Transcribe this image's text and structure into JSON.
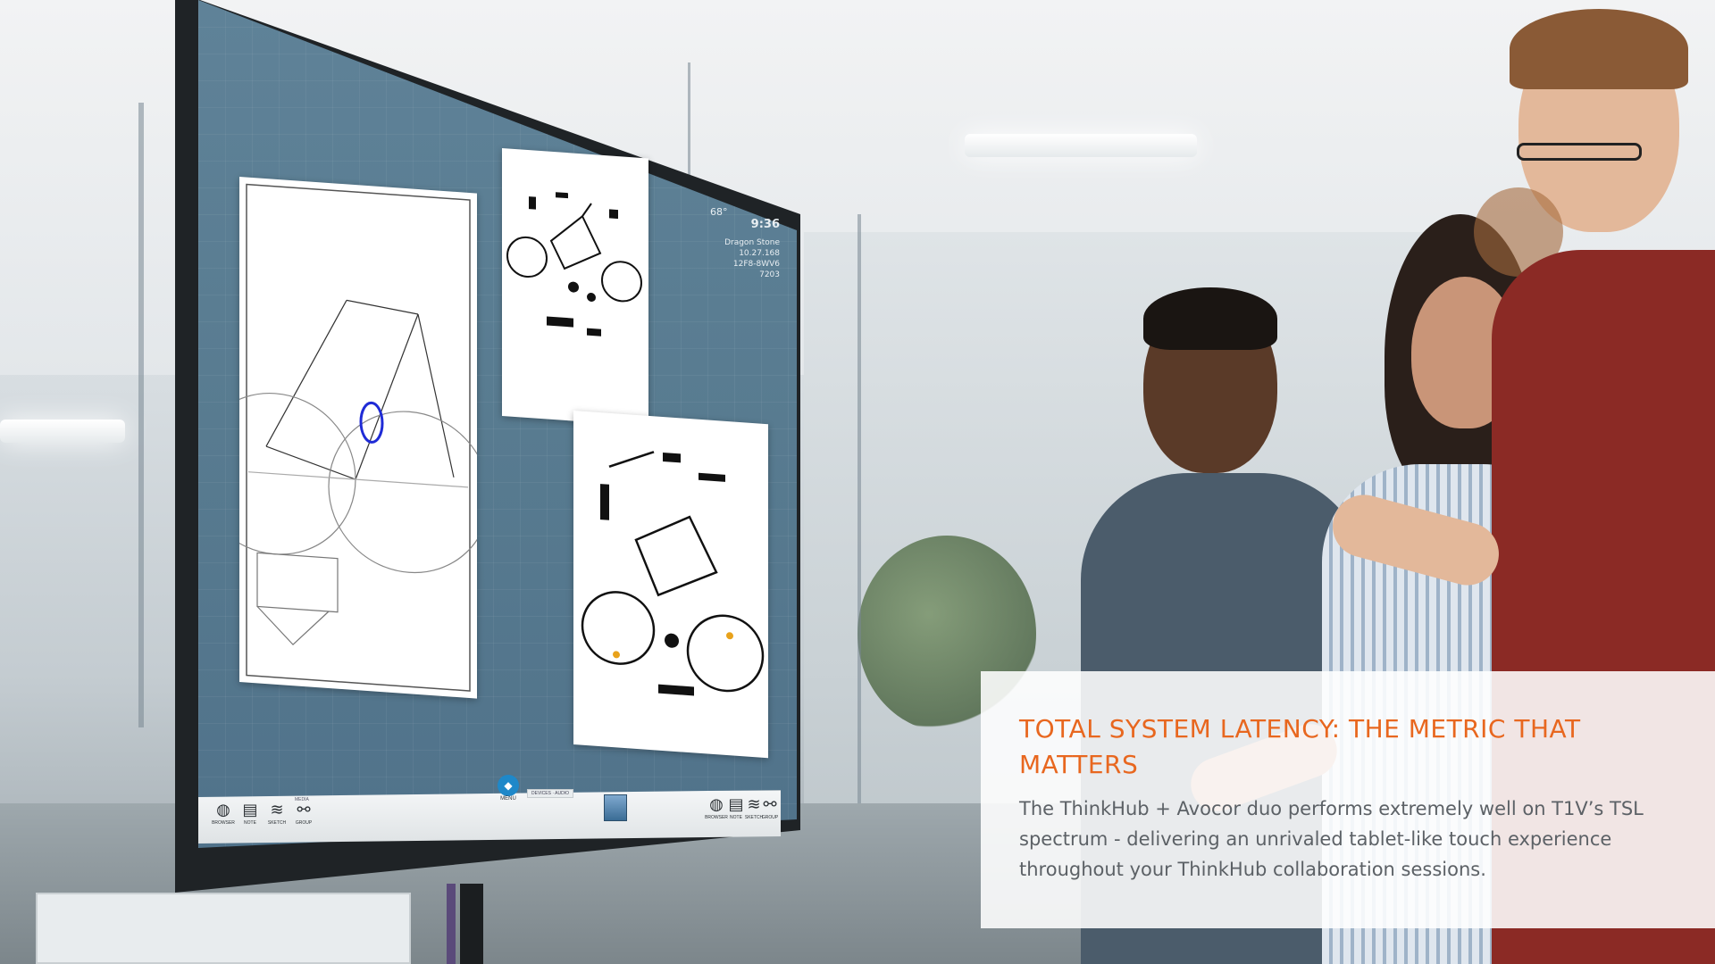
{
  "card": {
    "title": "TOTAL SYSTEM LATENCY: THE METRIC THAT MATTERS",
    "body": "The ThinkHub + Avocor duo performs extremely well on T1V’s TSL spectrum - delivering an unrivaled tablet-like touch experience throughout your ThinkHub collaboration sessions.",
    "title_color": "#e8671f",
    "body_color": "#5c6166"
  },
  "display": {
    "screen_color": "#587b90",
    "status": {
      "temperature": "68°",
      "time": "9:36",
      "lines": [
        "Dragon Stone",
        "10.27.168",
        "12F8-8WV6",
        "7203"
      ]
    },
    "taskbar": {
      "left_icons": [
        {
          "icon": "globe-icon",
          "label": "BROWSER"
        },
        {
          "icon": "note-icon",
          "label": "NOTE"
        },
        {
          "icon": "sketch-icon",
          "label": "SKETCH"
        },
        {
          "icon": "group-icon",
          "label": "GROUP"
        }
      ],
      "media_label": "MEDIA",
      "menu_label": "MENU",
      "tabs": "DEVICES · AUDIO",
      "right_icons": [
        {
          "icon": "globe-icon",
          "label": "BROWSER"
        },
        {
          "icon": "note-icon",
          "label": "NOTE"
        },
        {
          "icon": "sketch-icon",
          "label": "SKETCH"
        },
        {
          "icon": "group-icon",
          "label": "GROUP"
        }
      ]
    }
  }
}
